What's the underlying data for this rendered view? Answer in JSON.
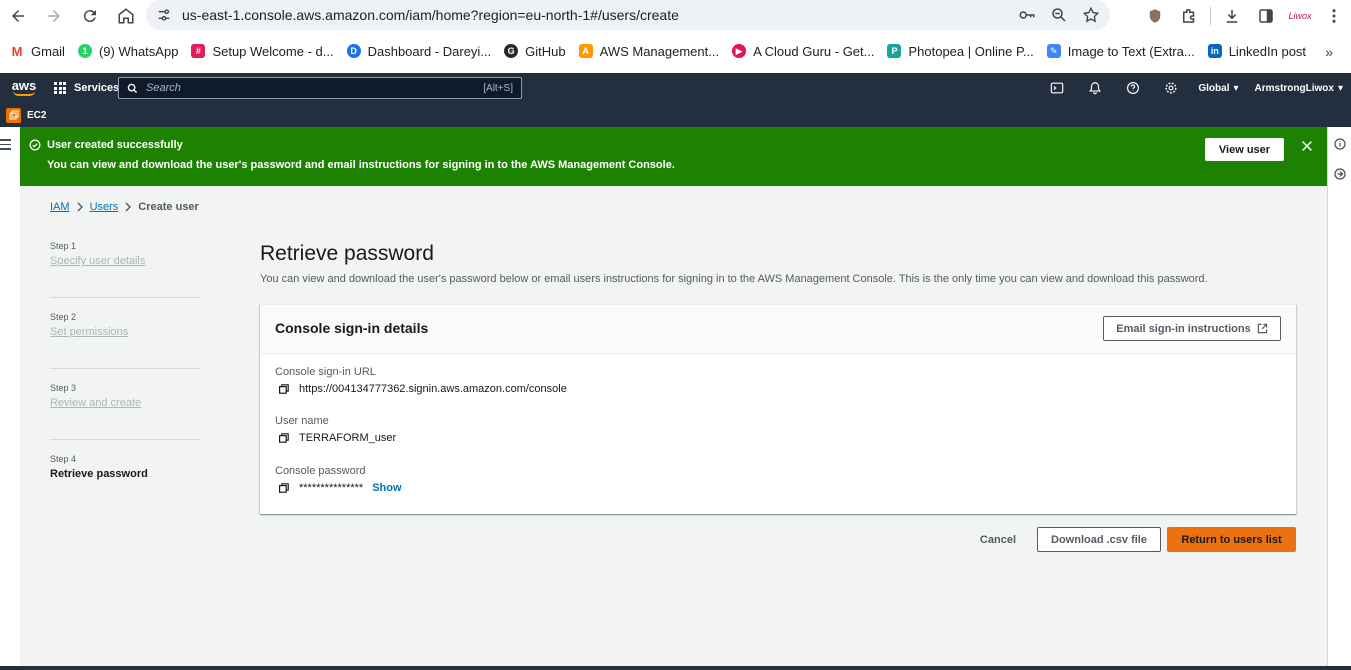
{
  "browser": {
    "url": "us-east-1.console.aws.amazon.com/iam/home?region=eu-north-1#/users/create",
    "profile_label": "Liwox"
  },
  "bookmarks": [
    {
      "label": "Gmail",
      "color": "#ea4335",
      "glyph": "M"
    },
    {
      "label": "(9) WhatsApp",
      "color": "#25d366",
      "glyph": "1"
    },
    {
      "label": "Setup Welcome - d...",
      "color": "#e01e5a",
      "glyph": "#"
    },
    {
      "label": "Dashboard - Dareyi...",
      "color": "#1a73e8",
      "glyph": "D"
    },
    {
      "label": "GitHub",
      "color": "#24292e",
      "glyph": "G"
    },
    {
      "label": "AWS Management...",
      "color": "#ff9900",
      "glyph": "A"
    },
    {
      "label": "A Cloud Guru - Get...",
      "color": "#e0115f",
      "glyph": "▶"
    },
    {
      "label": "Photopea | Online P...",
      "color": "#18a497",
      "glyph": "P"
    },
    {
      "label": "Image to Text (Extra...",
      "color": "#4285f4",
      "glyph": "✎"
    },
    {
      "label": "LinkedIn post",
      "color": "#0a66c2",
      "glyph": "in"
    }
  ],
  "aws_nav": {
    "logo": "aws",
    "services_label": "Services",
    "search_placeholder": "Search",
    "search_shortcut": "[Alt+S]",
    "region_label": "Global",
    "account_label": "ArmstrongLiwox",
    "pinned_service": "EC2"
  },
  "flash": {
    "title": "User created successfully",
    "message": "You can view and download the user's password and email instructions for signing in to the AWS Management Console.",
    "view_user_label": "View user"
  },
  "breadcrumb": {
    "iam": "IAM",
    "users": "Users",
    "current": "Create user"
  },
  "steps": [
    {
      "num": "Step 1",
      "label": "Specify user details",
      "active": false
    },
    {
      "num": "Step 2",
      "label": "Set permissions",
      "active": false
    },
    {
      "num": "Step 3",
      "label": "Review and create",
      "active": false
    },
    {
      "num": "Step 4",
      "label": "Retrieve password",
      "active": true
    }
  ],
  "main": {
    "title": "Retrieve password",
    "description": "You can view and download the user's password below or email users instructions for signing in to the AWS Management Console. This is the only time you can view and download this password."
  },
  "panel": {
    "title": "Console sign-in details",
    "email_button_label": "Email sign-in instructions",
    "url_label": "Console sign-in URL",
    "url_value": "https://004134777362.signin.aws.amazon.com/console",
    "username_label": "User name",
    "username_value": "TERRAFORM_user",
    "password_label": "Console password",
    "password_value": "***************",
    "show_label": "Show"
  },
  "actions": {
    "cancel": "Cancel",
    "download_csv": "Download .csv file",
    "return": "Return to users list"
  },
  "colors": {
    "success_green": "#1d8102",
    "aws_nav": "#232f3e",
    "primary_orange": "#ec7211",
    "link_blue": "#0073bb"
  }
}
